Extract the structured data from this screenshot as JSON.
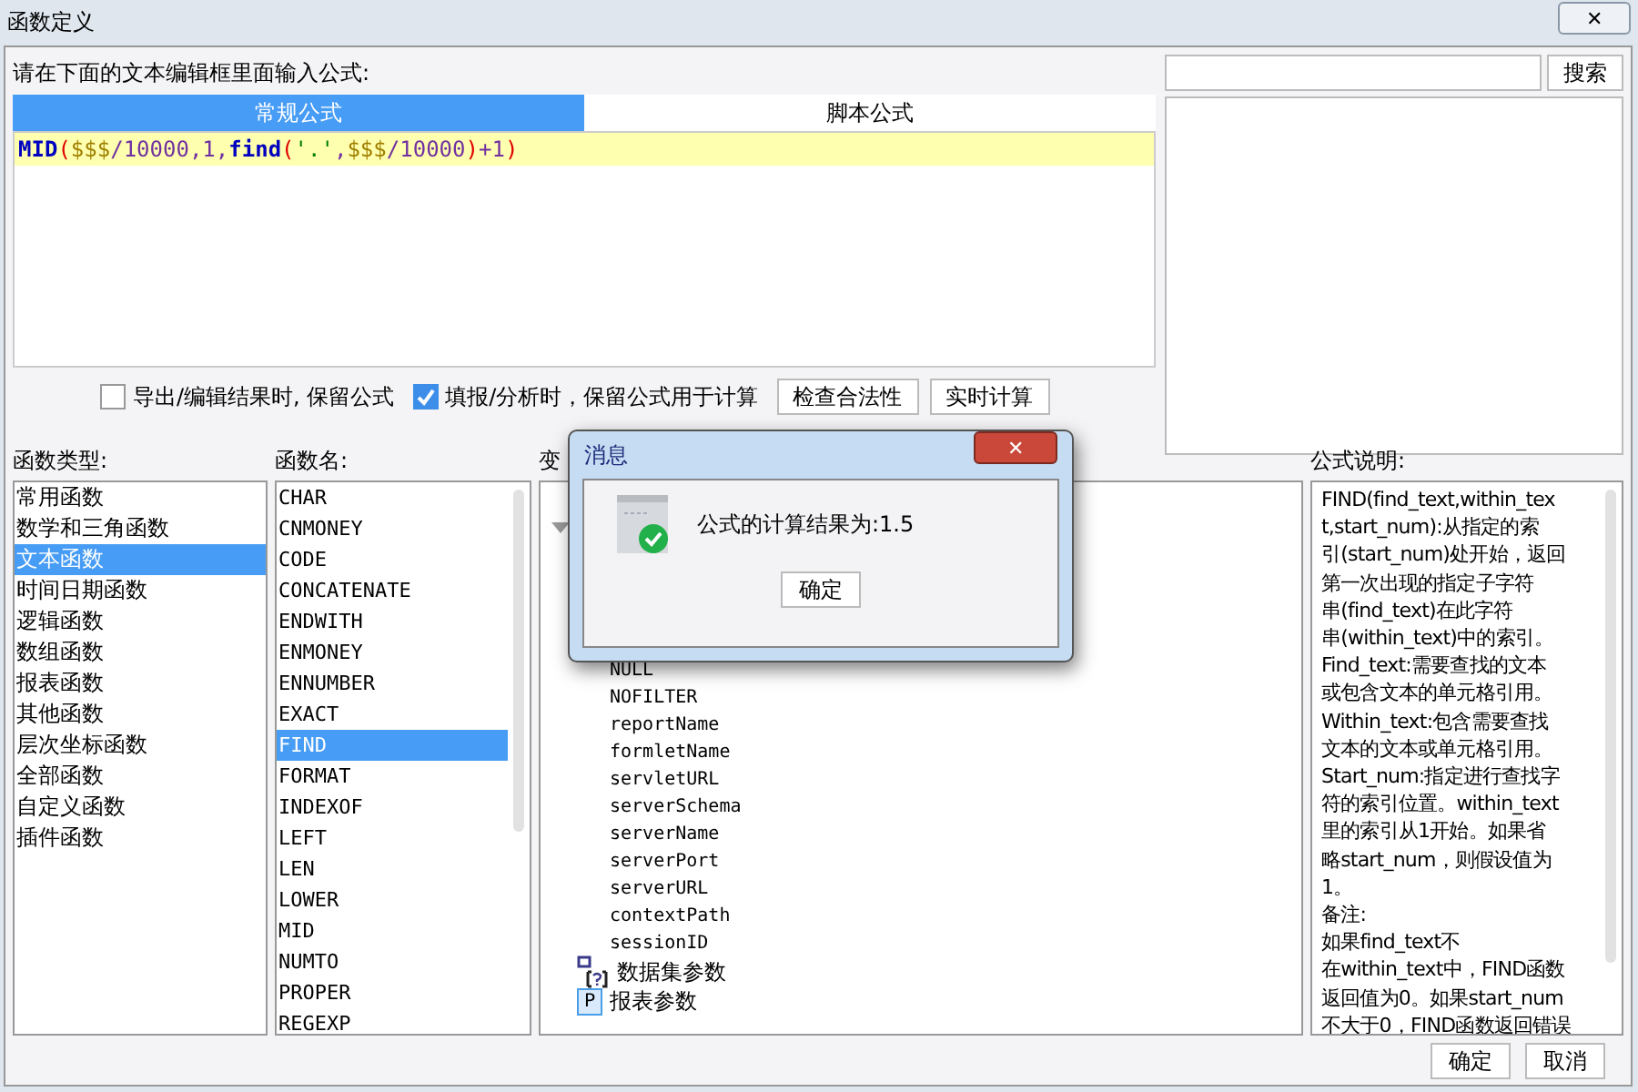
{
  "window": {
    "title": "函数定义",
    "close": "✕"
  },
  "prompt": "请在下面的文本编辑框里面输入公式:",
  "search": {
    "button": "搜索"
  },
  "tabs": [
    {
      "label": "常规公式",
      "selected": true
    },
    {
      "label": "脚本公式",
      "selected": false
    }
  ],
  "formula": [
    {
      "text": "MID",
      "kind": "function"
    },
    {
      "text": "(",
      "kind": "paren"
    },
    {
      "text": "$$$",
      "kind": "variable"
    },
    {
      "text": "/10000,1,",
      "kind": "number"
    },
    {
      "text": "find",
      "kind": "function"
    },
    {
      "text": "(",
      "kind": "paren"
    },
    {
      "text": "'.'",
      "kind": "string"
    },
    {
      "text": ",",
      "kind": "number"
    },
    {
      "text": "$$$",
      "kind": "variable"
    },
    {
      "text": "/10000",
      "kind": "number"
    },
    {
      "text": ")",
      "kind": "paren"
    },
    {
      "text": "+1",
      "kind": "number"
    },
    {
      "text": ")",
      "kind": "paren"
    }
  ],
  "options": [
    {
      "label": "导出/编辑结果时, 保留公式",
      "checked": false
    },
    {
      "label": "填报/分析时，保留公式用于计算",
      "checked": true
    }
  ],
  "actions": [
    "检查合法性",
    "实时计算"
  ],
  "types": {
    "label": "函数类型:",
    "items": [
      {
        "label": "常用函数",
        "selected": false
      },
      {
        "label": "数学和三角函数",
        "selected": false
      },
      {
        "label": "文本函数",
        "selected": true
      },
      {
        "label": "时间日期函数",
        "selected": false
      },
      {
        "label": "逻辑函数",
        "selected": false
      },
      {
        "label": "数组函数",
        "selected": false
      },
      {
        "label": "报表函数",
        "selected": false
      },
      {
        "label": "其他函数",
        "selected": false
      },
      {
        "label": "层次坐标函数",
        "selected": false
      },
      {
        "label": "全部函数",
        "selected": false
      },
      {
        "label": "自定义函数",
        "selected": false
      },
      {
        "label": "插件函数",
        "selected": false
      }
    ]
  },
  "functions": {
    "label": "函数名:",
    "items": [
      {
        "label": "CHAR",
        "selected": false
      },
      {
        "label": "CNMONEY",
        "selected": false
      },
      {
        "label": "CODE",
        "selected": false
      },
      {
        "label": "CONCATENATE",
        "selected": false
      },
      {
        "label": "ENDWITH",
        "selected": false
      },
      {
        "label": "ENMONEY",
        "selected": false
      },
      {
        "label": "ENNUMBER",
        "selected": false
      },
      {
        "label": "EXACT",
        "selected": false
      },
      {
        "label": "FIND",
        "selected": true
      },
      {
        "label": "FORMAT",
        "selected": false
      },
      {
        "label": "INDEXOF",
        "selected": false
      },
      {
        "label": "LEFT",
        "selected": false
      },
      {
        "label": "LEN",
        "selected": false
      },
      {
        "label": "LOWER",
        "selected": false
      },
      {
        "label": "MID",
        "selected": false
      },
      {
        "label": "NUMTO",
        "selected": false
      },
      {
        "label": "PROPER",
        "selected": false
      },
      {
        "label": "REGEXP",
        "selected": false
      }
    ]
  },
  "variables": {
    "label": "变",
    "nodes": [
      {
        "kind": "group",
        "expanded": true,
        "children": [
          {
            "label": "NULL"
          },
          {
            "label": "NOFILTER"
          },
          {
            "label": "reportName"
          },
          {
            "label": "formletName"
          },
          {
            "label": "servletURL"
          },
          {
            "label": "serverSchema"
          },
          {
            "label": "serverName"
          },
          {
            "label": "serverPort"
          },
          {
            "label": "serverURL"
          },
          {
            "label": "contextPath"
          },
          {
            "label": "sessionID"
          }
        ]
      },
      {
        "kind": "dataset",
        "label": "数据集参数"
      },
      {
        "kind": "param",
        "label": "报表参数",
        "icon": "P"
      }
    ]
  },
  "description": {
    "label": "公式说明:",
    "lines": [
      "FIND(find_text,within_tex",
      "t,start_num):从指定的索",
      "引(start_num)处开始，返回",
      "第一次出现的指定子字符",
      "串(find_text)在此字符",
      "串(within_text)中的索引。",
      "Find_text:需要查找的文本",
      "或包含文本的单元格引用。",
      "Within_text:包含需要查找",
      "文本的文本或单元格引用。",
      "Start_num:指定进行查找字",
      "符的索引位置。within_text",
      "里的索引从1开始。如果省",
      "略start_num，则假设值为",
      "1。",
      "备注:",
      "如果find_text不",
      "在within_text中，FIND函数",
      "返回值为0。如果start_num",
      "不大于0，FIND函数返回错误"
    ]
  },
  "buttons": [
    "确定",
    "取消"
  ],
  "message": {
    "title": "消息",
    "close": "✕",
    "text": "公式的计算结果为:1.5",
    "button": "确定"
  }
}
